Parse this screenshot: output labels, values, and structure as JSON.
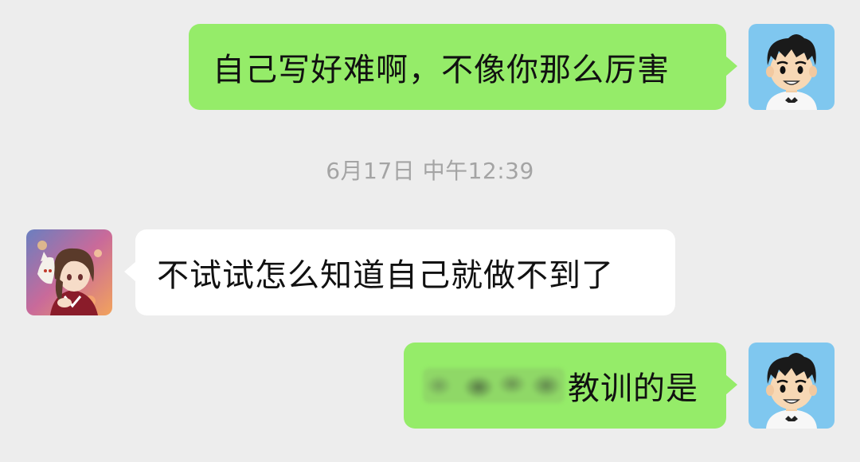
{
  "messages": [
    {
      "side": "right",
      "text": "自己写好难啊，不像你那么厉害"
    },
    {
      "side": "left",
      "text": "不试试怎么知道自己就做不到了"
    },
    {
      "side": "right",
      "text": "教训的是",
      "redacted_prefix": true
    }
  ],
  "timestamp": "6月17日 中午12:39",
  "colors": {
    "background": "#ededed",
    "my_bubble": "#95ec69",
    "their_bubble": "#ffffff",
    "timestamp_text": "#a4a4a4"
  },
  "avatars": {
    "mine": "cartoon-boy-avatar",
    "theirs": "anime-girl-avatar"
  }
}
